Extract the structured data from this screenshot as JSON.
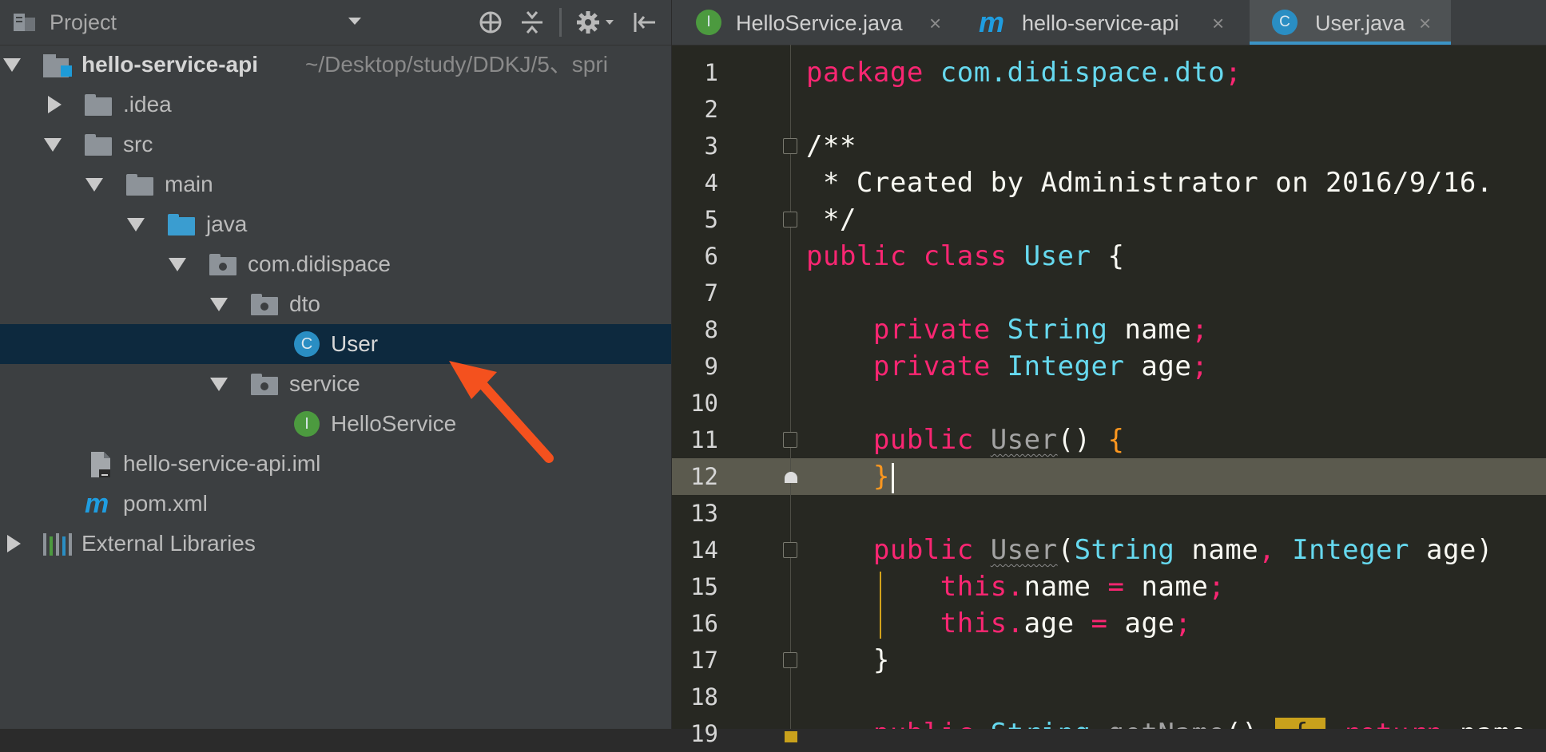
{
  "project_panel": {
    "title": "Project",
    "tree": [
      {
        "label": "hello-service-api",
        "path": "~/Desktop/study/DDKJ/5、spri",
        "depth": 0,
        "expanded": true,
        "icon": "module-folder-icon"
      },
      {
        "label": ".idea",
        "depth": 1,
        "expanded": false,
        "icon": "folder-icon"
      },
      {
        "label": "src",
        "depth": 1,
        "expanded": true,
        "icon": "folder-icon"
      },
      {
        "label": "main",
        "depth": 2,
        "expanded": true,
        "icon": "folder-icon"
      },
      {
        "label": "java",
        "depth": 3,
        "expanded": true,
        "icon": "source-folder-icon"
      },
      {
        "label": "com.didispace",
        "depth": 4,
        "expanded": true,
        "icon": "package-icon"
      },
      {
        "label": "dto",
        "depth": 5,
        "expanded": true,
        "icon": "package-icon"
      },
      {
        "label": "User",
        "depth": 6,
        "icon": "class-icon",
        "badge": "C",
        "selected": true
      },
      {
        "label": "service",
        "depth": 5,
        "expanded": true,
        "icon": "package-icon"
      },
      {
        "label": "HelloService",
        "depth": 6,
        "icon": "interface-icon",
        "badge": "I"
      },
      {
        "label": "hello-service-api.iml",
        "depth": 2,
        "icon": "iml-file-icon"
      },
      {
        "label": "pom.xml",
        "depth": 2,
        "icon": "maven-icon",
        "badge": "m"
      },
      {
        "label": "External Libraries",
        "depth": 0,
        "expanded": false,
        "icon": "libraries-icon"
      }
    ]
  },
  "editor": {
    "tabs": [
      {
        "label": "HelloService.java",
        "icon": "interface-icon",
        "badge": "I",
        "active": false
      },
      {
        "label": "hello-service-api",
        "icon": "maven-icon",
        "badge": "m",
        "active": false
      },
      {
        "label": "User.java",
        "icon": "class-icon",
        "badge": "C",
        "active": true
      }
    ],
    "close_glyph": "×",
    "current_line": 12,
    "lines": [
      {
        "n": "1",
        "tokens": [
          [
            "kw",
            "package "
          ],
          [
            "ty",
            "com.didispace.dto"
          ],
          [
            "kw",
            ";"
          ]
        ]
      },
      {
        "n": "2",
        "tokens": []
      },
      {
        "n": "3",
        "tokens": [
          [
            "tx",
            "/**"
          ]
        ]
      },
      {
        "n": "4",
        "tokens": [
          [
            "tx",
            " * Created by Administrator on 2016/9/16."
          ]
        ]
      },
      {
        "n": "5",
        "tokens": [
          [
            "tx",
            " */"
          ]
        ]
      },
      {
        "n": "6",
        "tokens": [
          [
            "kw",
            "public class "
          ],
          [
            "ty",
            "User"
          ],
          [
            "tx",
            " {"
          ]
        ]
      },
      {
        "n": "7",
        "tokens": []
      },
      {
        "n": "8",
        "tokens": [
          [
            "tx",
            "    "
          ],
          [
            "kw",
            "private "
          ],
          [
            "ty",
            "String "
          ],
          [
            "tx",
            "name"
          ],
          [
            "kw",
            ";"
          ]
        ]
      },
      {
        "n": "9",
        "tokens": [
          [
            "tx",
            "    "
          ],
          [
            "kw",
            "private "
          ],
          [
            "ty",
            "Integer "
          ],
          [
            "tx",
            "age"
          ],
          [
            "kw",
            ";"
          ]
        ]
      },
      {
        "n": "10",
        "tokens": []
      },
      {
        "n": "11",
        "tokens": [
          [
            "tx",
            "    "
          ],
          [
            "kw",
            "public "
          ],
          [
            "us",
            "User"
          ],
          [
            "tx",
            "() "
          ],
          [
            "or",
            "{"
          ]
        ]
      },
      {
        "n": "12",
        "tokens": [
          [
            "tx",
            "    "
          ],
          [
            "or",
            "}"
          ],
          [
            "caret",
            ""
          ]
        ]
      },
      {
        "n": "13",
        "tokens": []
      },
      {
        "n": "14",
        "tokens": [
          [
            "tx",
            "    "
          ],
          [
            "kw",
            "public "
          ],
          [
            "us",
            "User"
          ],
          [
            "tx",
            "("
          ],
          [
            "ty",
            "String "
          ],
          [
            "tx",
            "name"
          ],
          [
            "kw",
            ", "
          ],
          [
            "ty",
            "Integer "
          ],
          [
            "tx",
            "age)"
          ]
        ]
      },
      {
        "n": "15",
        "tokens": [
          [
            "tx",
            "        "
          ],
          [
            "kw",
            "this."
          ],
          [
            "tx",
            "name "
          ],
          [
            "kw",
            "= "
          ],
          [
            "tx",
            "name"
          ],
          [
            "kw",
            ";"
          ]
        ]
      },
      {
        "n": "16",
        "tokens": [
          [
            "tx",
            "        "
          ],
          [
            "kw",
            "this."
          ],
          [
            "tx",
            "age "
          ],
          [
            "kw",
            "= "
          ],
          [
            "tx",
            "age"
          ],
          [
            "kw",
            ";"
          ]
        ]
      },
      {
        "n": "17",
        "tokens": [
          [
            "tx",
            "    }"
          ]
        ]
      },
      {
        "n": "18",
        "tokens": []
      },
      {
        "n": "19",
        "tokens": [
          [
            "tx",
            "    "
          ],
          [
            "kw",
            "public "
          ],
          [
            "ty",
            "String "
          ],
          [
            "us",
            "getName"
          ],
          [
            "tx",
            "() "
          ],
          [
            "box",
            " { "
          ],
          [
            "kw",
            " return "
          ],
          [
            "tx",
            "name"
          ]
        ]
      }
    ]
  },
  "colors": {
    "keyword": "#f92672",
    "type": "#66d9ef",
    "brace": "#fd971f",
    "selection": "#0d293e",
    "annotation_arrow": "#f4511e"
  }
}
